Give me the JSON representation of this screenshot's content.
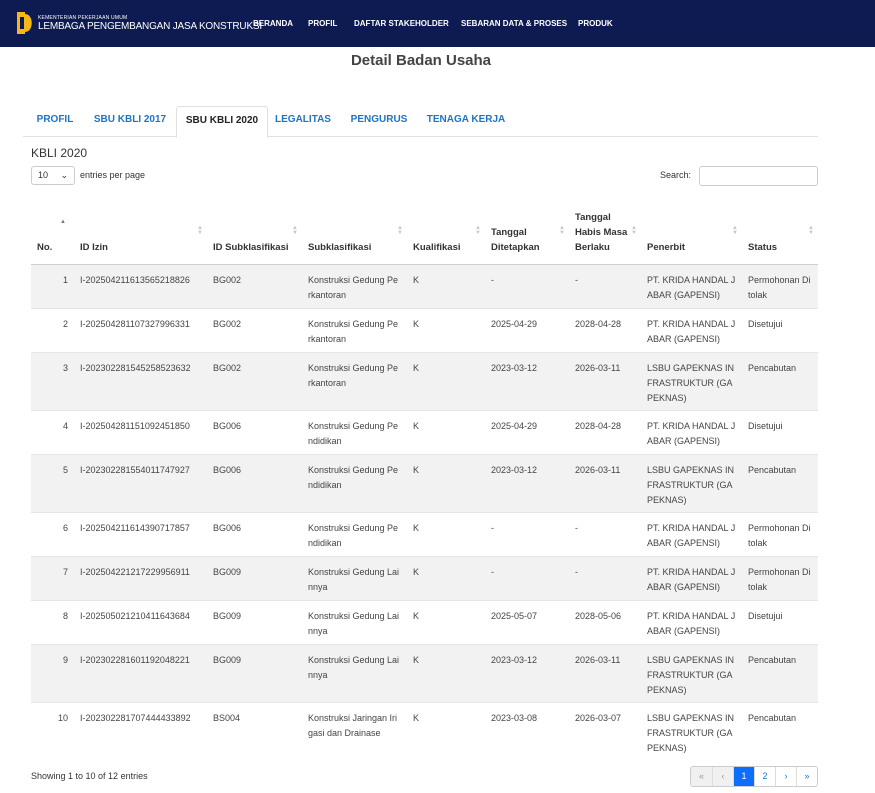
{
  "navbar": {
    "brand_small": "KEMENTERIAN PEKERJAAN UMUM",
    "brand_big": "LEMBAGA PENGEMBANGAN JASA KONSTRUKSI",
    "items": [
      "BERANDA",
      "PROFIL",
      "DAFTAR STAKEHOLDER",
      "SEBARAN DATA & PROSES",
      "PRODUK"
    ]
  },
  "page_title": "Detail Badan Usaha",
  "tabs": [
    "PROFIL",
    "SBU KBLI 2017",
    "SBU KBLI 2020",
    "LEGALITAS",
    "PENGURUS",
    "TENAGA KERJA"
  ],
  "active_tab": "SBU KBLI 2020",
  "section_title": "KBLI 2020",
  "length_menu": {
    "value": "10",
    "label": "entries per page"
  },
  "search": {
    "label": "Search:",
    "value": ""
  },
  "table": {
    "headers": [
      "No.",
      "ID Izin",
      "ID Subklasifikasi",
      "Subklasifikasi",
      "Kualifikasi",
      "Tanggal Ditetapkan",
      "Tanggal Habis Masa Berlaku",
      "Penerbit",
      "Status"
    ],
    "rows": [
      [
        "1",
        "I-202504211613565218826",
        "BG002",
        "Konstruksi Gedung Perkantoran",
        "K",
        "-",
        "-",
        "PT. KRIDA HANDAL JABAR (GAPENSI)",
        "Permohonan Ditolak"
      ],
      [
        "2",
        "I-202504281107327996331",
        "BG002",
        "Konstruksi Gedung Perkantoran",
        "K",
        "2025-04-29",
        "2028-04-28",
        "PT. KRIDA HANDAL JABAR (GAPENSI)",
        "Disetujui"
      ],
      [
        "3",
        "I-202302281545258523632",
        "BG002",
        "Konstruksi Gedung Perkantoran",
        "K",
        "2023-03-12",
        "2026-03-11",
        "LSBU GAPEKNAS INFRASTRUKTUR (GAPEKNAS)",
        "Pencabutan"
      ],
      [
        "4",
        "I-202504281151092451850",
        "BG006",
        "Konstruksi Gedung Pendidikan",
        "K",
        "2025-04-29",
        "2028-04-28",
        "PT. KRIDA HANDAL JABAR (GAPENSI)",
        "Disetujui"
      ],
      [
        "5",
        "I-202302281554011747927",
        "BG006",
        "Konstruksi Gedung Pendidikan",
        "K",
        "2023-03-12",
        "2026-03-11",
        "LSBU GAPEKNAS INFRASTRUKTUR (GAPEKNAS)",
        "Pencabutan"
      ],
      [
        "6",
        "I-202504211614390717857",
        "BG006",
        "Konstruksi Gedung Pendidikan",
        "K",
        "-",
        "-",
        "PT. KRIDA HANDAL JABAR (GAPENSI)",
        "Permohonan Ditolak"
      ],
      [
        "7",
        "I-202504221217229956911",
        "BG009",
        "Konstruksi Gedung Lainnya",
        "K",
        "-",
        "-",
        "PT. KRIDA HANDAL JABAR (GAPENSI)",
        "Permohonan Ditolak"
      ],
      [
        "8",
        "I-202505021210411643684",
        "BG009",
        "Konstruksi Gedung Lainnya",
        "K",
        "2025-05-07",
        "2028-05-06",
        "PT. KRIDA HANDAL JABAR (GAPENSI)",
        "Disetujui"
      ],
      [
        "9",
        "I-202302281601192048221",
        "BG009",
        "Konstruksi Gedung Lainnya",
        "K",
        "2023-03-12",
        "2026-03-11",
        "LSBU GAPEKNAS INFRASTRUKTUR (GAPEKNAS)",
        "Pencabutan"
      ],
      [
        "10",
        "I-202302281707444433892",
        "BS004",
        "Konstruksi Jaringan Irigasi dan Drainase",
        "K",
        "2023-03-08",
        "2026-03-07",
        "LSBU GAPEKNAS INFRASTRUKTUR (GAPEKNAS)",
        "Pencabutan"
      ]
    ]
  },
  "footer": {
    "info": "Showing 1 to 10 of 12 entries",
    "pagination": [
      "«",
      "‹",
      "1",
      "2",
      "›",
      "»"
    ],
    "current_page": "1"
  },
  "colors": {
    "navbar": "#0e1a52",
    "link": "#1e74c4",
    "active_page": "#0d6efd"
  }
}
